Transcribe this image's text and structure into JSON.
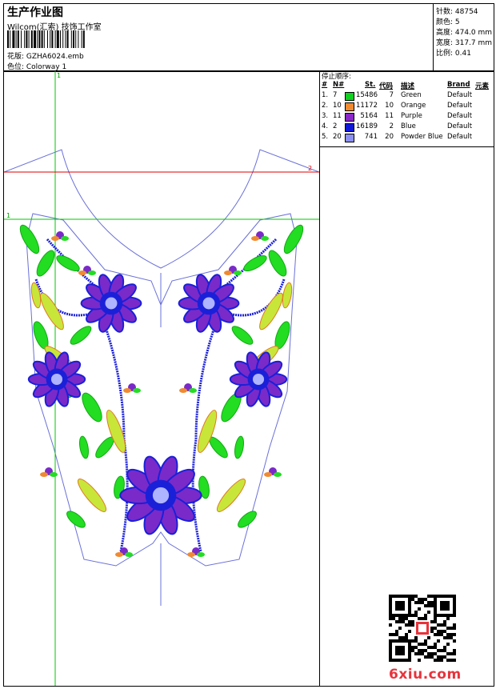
{
  "header": {
    "title": "生产作业图",
    "company": "Wilcom(汇索) 技饰工作室",
    "design": "花版:  GZHA6024.emb",
    "colorway": "色位:  Colorway 1"
  },
  "stats": [
    {
      "label": "针数: 48754"
    },
    {
      "label": "颜色: 5"
    },
    {
      "label": "高度: 474.0 mm"
    },
    {
      "label": "宽度: 317.7 mm"
    },
    {
      "label": "比例: 0.41"
    }
  ],
  "stop_sequence": {
    "heading": "停止顺序:",
    "columns": [
      "#",
      "N#",
      "St.",
      "代码",
      "描述",
      "Brand",
      "元素"
    ],
    "rows": [
      {
        "idx": "1.",
        "n": "7",
        "color": "#10d020",
        "stitches": "15486",
        "code": "7",
        "desc": "Green",
        "brand": "Default"
      },
      {
        "idx": "2.",
        "n": "10",
        "color": "#f08a30",
        "stitches": "11172",
        "code": "10",
        "desc": "Orange",
        "brand": "Default"
      },
      {
        "idx": "3.",
        "n": "11",
        "color": "#8a28c8",
        "stitches": "5164",
        "code": "11",
        "desc": "Purple",
        "brand": "Default"
      },
      {
        "idx": "4.",
        "n": "2",
        "color": "#1018d8",
        "stitches": "16189",
        "code": "2",
        "desc": "Blue",
        "brand": "Default"
      },
      {
        "idx": "5.",
        "n": "20",
        "color": "#8c90f0",
        "stitches": "741",
        "code": "20",
        "desc": "Powder Blue",
        "brand": "Default"
      }
    ]
  },
  "guides": {
    "v_label": "1",
    "h1_label": "2",
    "h2_label": "1"
  },
  "watermark": "6xiu.com",
  "colors": {
    "guide_green": "#00c800",
    "guide_red": "#e00000",
    "outline": "#6a70d8"
  }
}
